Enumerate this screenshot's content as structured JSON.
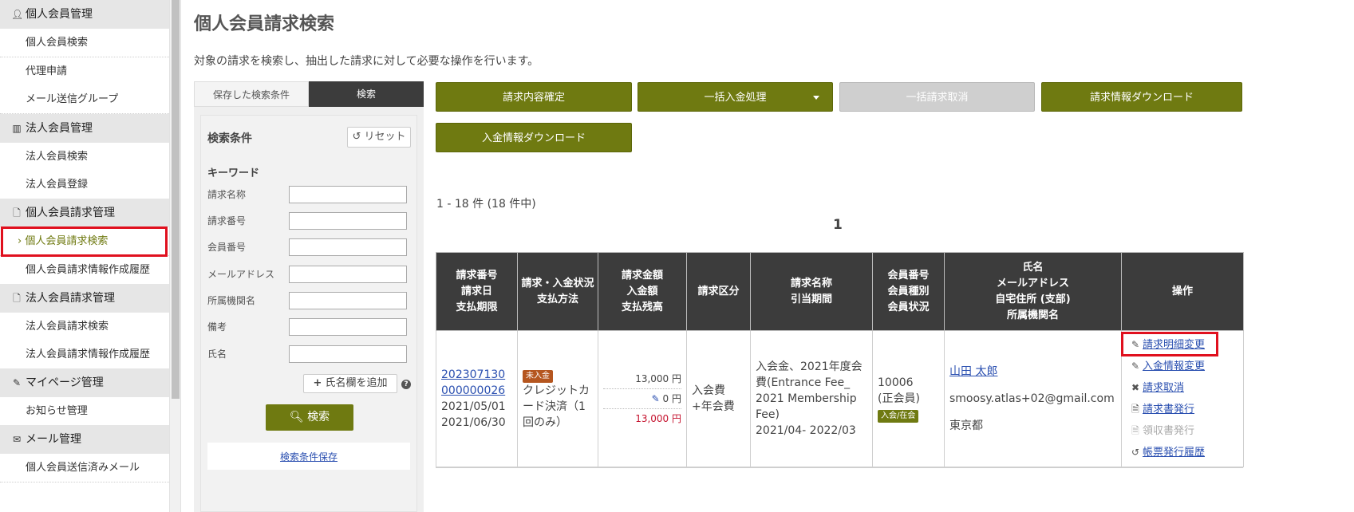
{
  "sidebar": {
    "sections": [
      {
        "icon": "user-icon",
        "title": "個人会員管理",
        "items": [
          "個人会員検索",
          "代理申請",
          "メール送信グループ"
        ]
      },
      {
        "icon": "building-icon",
        "title": "法人会員管理",
        "items": [
          "法人会員検索",
          "法人会員登録"
        ]
      },
      {
        "icon": "document-icon",
        "title": "個人会員請求管理",
        "items": [
          "個人会員請求検索",
          "個人会員請求情報作成履歴"
        ]
      },
      {
        "icon": "document-icon",
        "title": "法人会員請求管理",
        "items": [
          "法人会員請求検索",
          "法人会員請求情報作成履歴"
        ]
      },
      {
        "icon": "pencil-icon",
        "title": "マイページ管理",
        "items": [
          "お知らせ管理"
        ]
      },
      {
        "icon": "mail-icon",
        "title": "メール管理",
        "items": [
          "個人会員送信済みメール"
        ]
      }
    ],
    "active_item": "個人会員請求検索"
  },
  "page": {
    "title": "個人会員請求検索",
    "description": "対象の請求を検索し、抽出した請求に対して必要な操作を行います。"
  },
  "search_panel": {
    "tabs": [
      "保存した検索条件",
      "検索"
    ],
    "active_tab": "検索",
    "conditions_title": "検索条件",
    "reset_label": "リセット",
    "keyword_title": "キーワード",
    "fields": [
      "請求名称",
      "請求番号",
      "会員番号",
      "メールアドレス",
      "所属機関名",
      "備考",
      "氏名"
    ],
    "add_name_label": "氏名欄を追加",
    "help": "?",
    "search_label": "検索",
    "save_conditions_label": "検索条件保存"
  },
  "actions": {
    "confirm_label": "請求内容確定",
    "bulk_payment_label": "一括入金処理",
    "bulk_cancel_label": "一括請求取消",
    "invoice_download_label": "請求情報ダウンロード",
    "payment_download_label": "入金情報ダウンロード"
  },
  "results": {
    "count_text": "1 - 18 件 (18 件中)",
    "page_number": "1"
  },
  "table": {
    "headers": [
      [
        "請求番号",
        "請求日",
        "支払期限"
      ],
      [
        "請求・入金状況",
        "支払方法"
      ],
      [
        "請求金額",
        "入金額",
        "支払残高"
      ],
      [
        "請求区分"
      ],
      [
        "請求名称",
        "引当期間"
      ],
      [
        "会員番号",
        "会員種別",
        "会員状況"
      ],
      [
        "氏名",
        "メールアドレス",
        "自宅住所 (支部)",
        "所属機関名"
      ],
      [
        "操作"
      ]
    ],
    "rows": [
      {
        "invoice_number": "202307130000000026",
        "invoice_date": "2021/05/01",
        "due_date": "2021/06/30",
        "status_badge": "未入金",
        "payment_method": "クレジットカード決済（1回のみ）",
        "amount": "13,000 円",
        "paid": "0 円",
        "balance": "13,000 円",
        "category": "入会費+年会費",
        "invoice_name": "入会金、2021年度会費(Entrance Fee_ 2021 Membership Fee)",
        "period": "2021/04- 2022/03",
        "member_number": "10006",
        "member_type": "(正会員)",
        "member_status": "入会/在会",
        "name": "山田 太郎",
        "email": "smoosy.atlas+02@gmail.com",
        "address": "東京都",
        "operations": [
          "請求明細変更",
          "入金情報変更",
          "請求取消",
          "請求書発行",
          "領収書発行",
          "帳票発行履歴"
        ]
      }
    ]
  },
  "colors": {
    "accent": "#6f7a11",
    "header_dark": "#3c3c3c",
    "highlight_red": "#e0101e",
    "link_blue": "#2a4fb0",
    "amount_red": "#c5122e",
    "badge_orange": "#b5561f"
  }
}
